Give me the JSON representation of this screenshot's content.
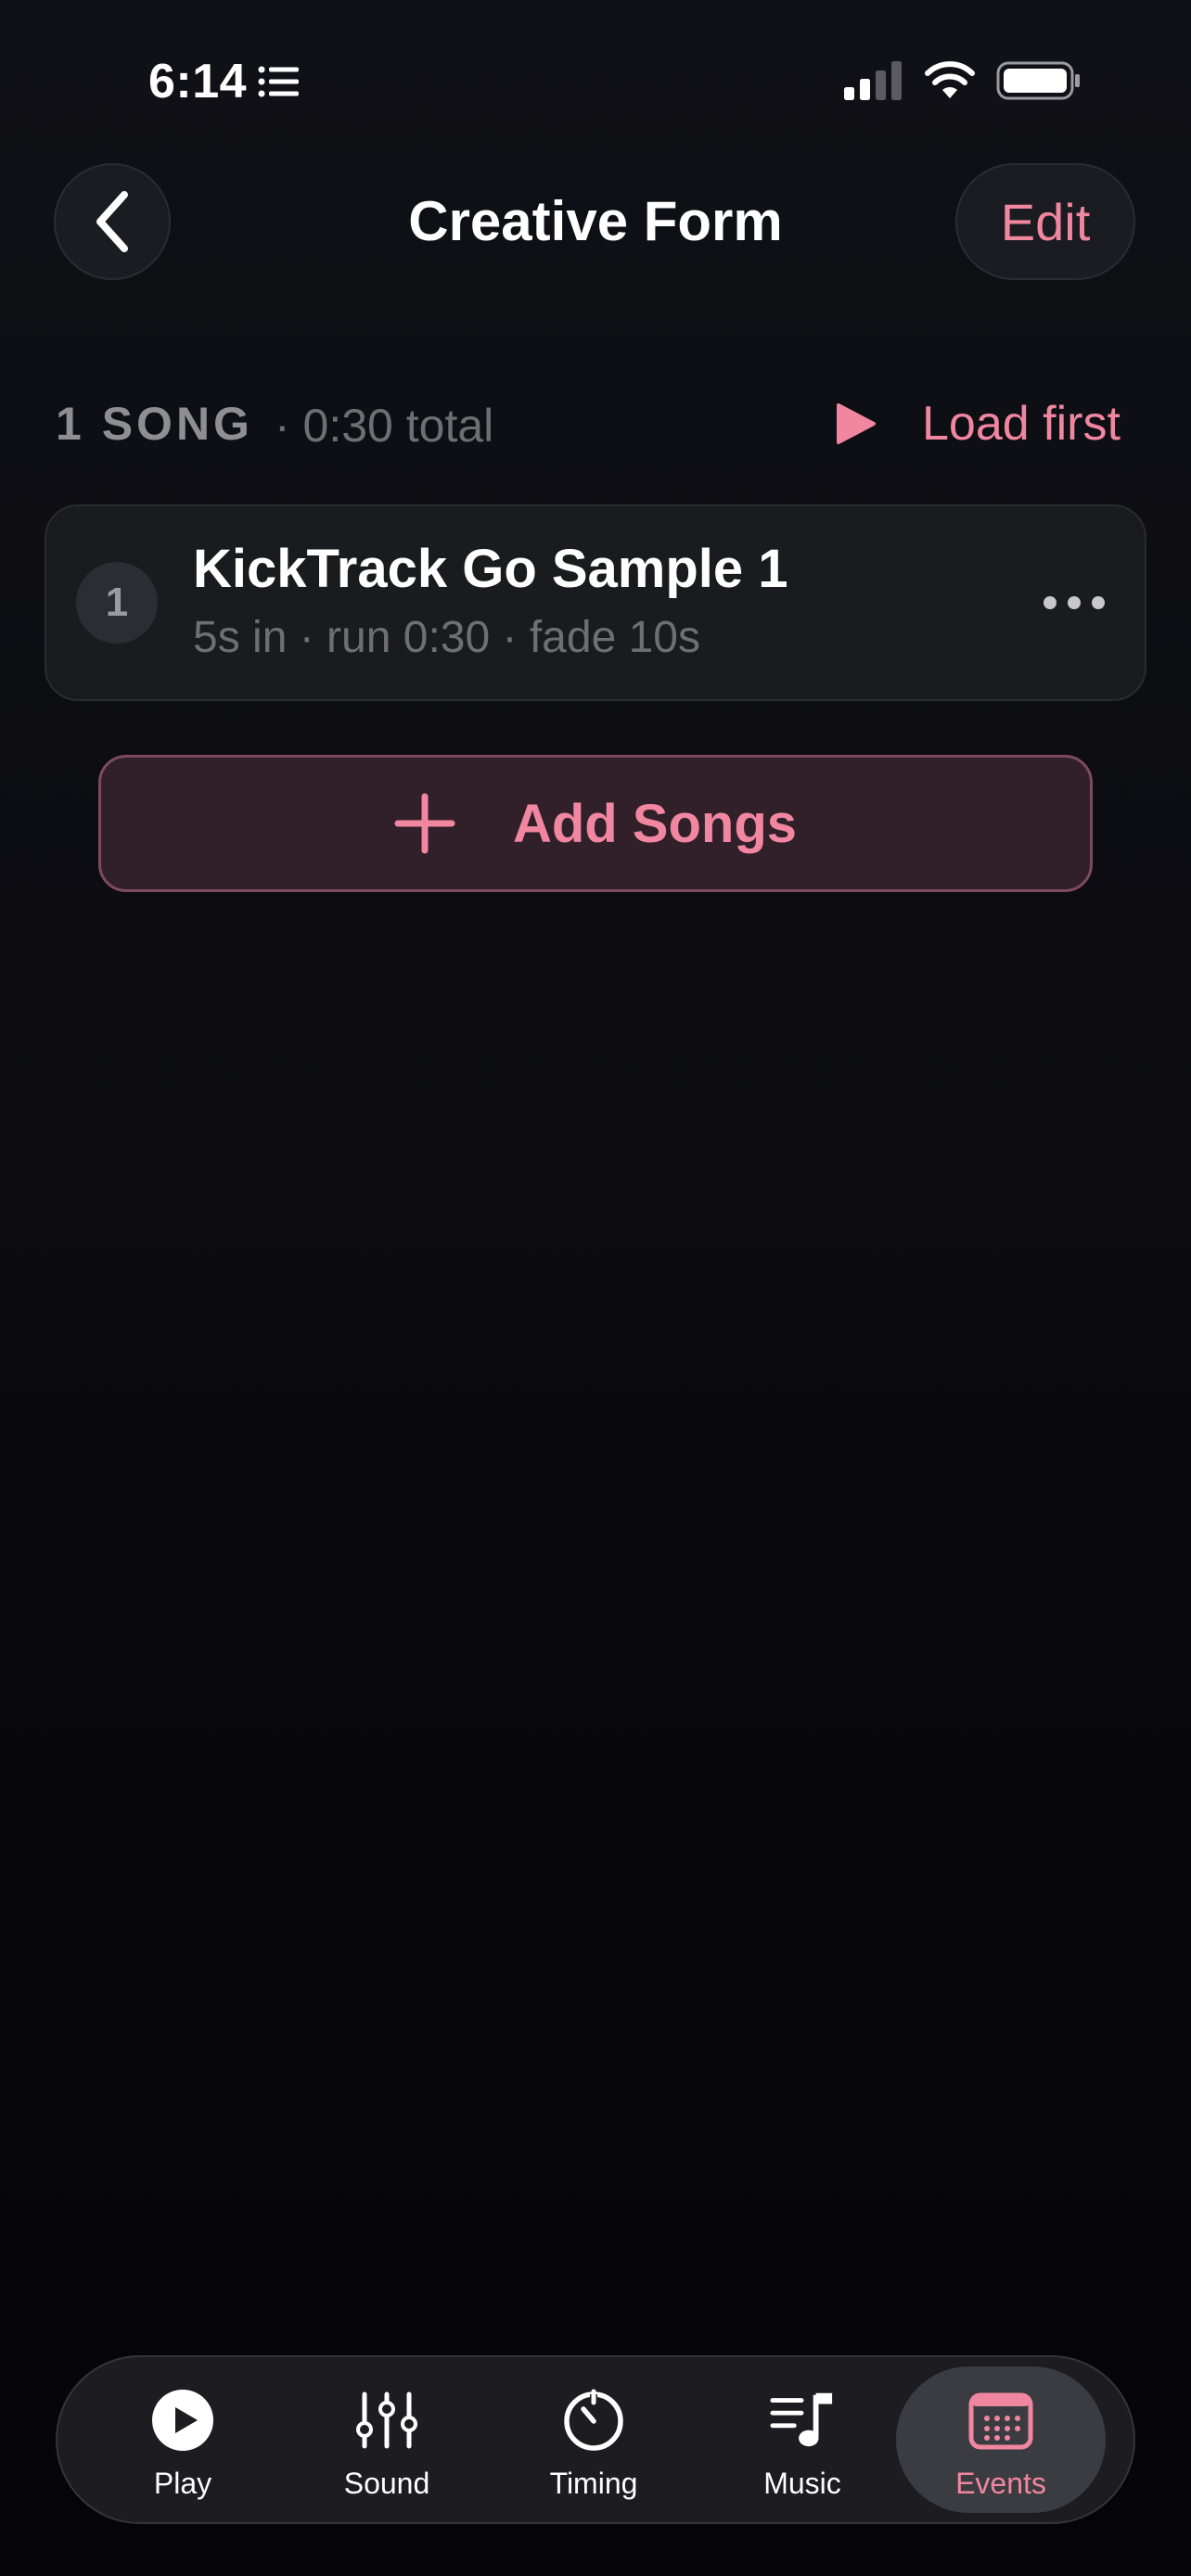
{
  "status_bar": {
    "time": "6:14"
  },
  "header": {
    "title": "Creative Form",
    "edit_label": "Edit"
  },
  "summary": {
    "song_count": "1 SONG",
    "total_duration": "· 0:30 total",
    "load_first_label": "Load first"
  },
  "songs": [
    {
      "number": "1",
      "title": "KickTrack Go Sample 1",
      "meta": "5s in · run 0:30 · fade 10s"
    }
  ],
  "add_songs_label": "Add Songs",
  "tabs": [
    {
      "label": "Play",
      "icon": "play-circle-icon",
      "active": false
    },
    {
      "label": "Sound",
      "icon": "sliders-icon",
      "active": false
    },
    {
      "label": "Timing",
      "icon": "timer-icon",
      "active": false
    },
    {
      "label": "Music",
      "icon": "music-list-icon",
      "active": false
    },
    {
      "label": "Events",
      "icon": "calendar-icon",
      "active": true
    }
  ],
  "colors": {
    "accent": "#f0869f",
    "background": "#0b0b10",
    "card": "#1a1b1f"
  }
}
